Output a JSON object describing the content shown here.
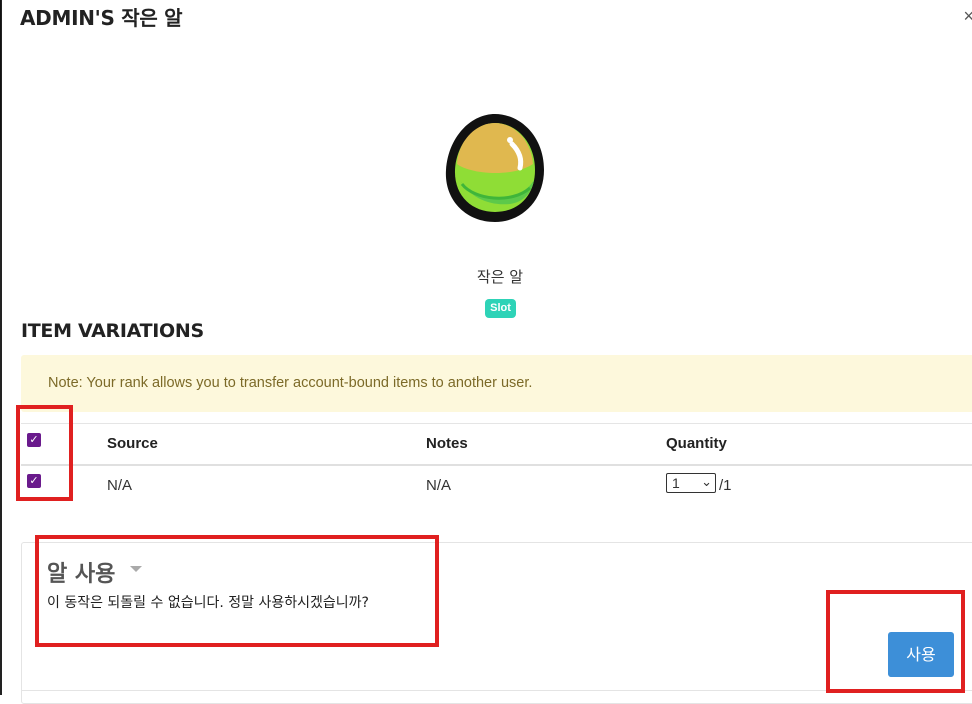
{
  "modal": {
    "title": "ADMIN'S 작은 알",
    "close_glyph": "×"
  },
  "item": {
    "name": "작은 알",
    "badge": "Slot",
    "image_icon": "green-egg"
  },
  "variations": {
    "title": "ITEM VARIATIONS",
    "note": "Note: Your rank allows you to transfer account-bound items to another user.",
    "columns": [
      "Source",
      "Notes",
      "Quantity"
    ],
    "rows": [
      {
        "checked": true,
        "source": "N/A",
        "notes": "N/A",
        "quantity": "1",
        "max": "/1"
      }
    ],
    "select_all_checked": true
  },
  "action": {
    "title": "알 사용",
    "description": "이 동작은 되돌릴 수 없습니다. 정말 사용하시겠습니까?",
    "button_label": "사용"
  },
  "colors": {
    "accent": "#3d8fd8",
    "checkbox": "#6a1a8c",
    "badge": "#2ed3b7",
    "note_bg": "#fdf8dc",
    "highlight": "#e02020"
  }
}
